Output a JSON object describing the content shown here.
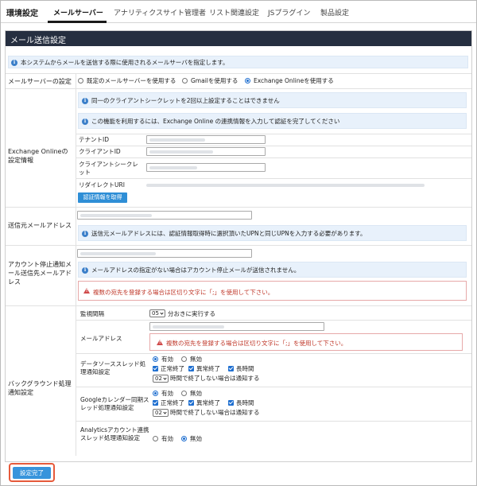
{
  "nav": {
    "title": "環境設定",
    "tabs": [
      "メールサーバー",
      "アナリティクスサイト管理者",
      "リスト関連設定",
      "JSプラグイン",
      "製品設定"
    ]
  },
  "section": {
    "title": "メール送信設定"
  },
  "intro": "本システムからメールを送信する際に使用されるメールサーバを指定します。",
  "mailserver": {
    "label": "メールサーバーの設定",
    "options": [
      "既定のメールサーバーを使用する",
      "Gmailを使用する",
      "Exchange Onlineを使用する"
    ],
    "selected": 2
  },
  "exchange": {
    "label": "Exchange Onlineの設定情報",
    "info1": "同一のクライアントシークレットを2回以上設定することはできません",
    "info2": "この機能を利用するには、Exchange Online の連携情報を入力して認証を完了してください",
    "fields": [
      "テナントID",
      "クライアントID",
      "クライアントシークレット",
      "リダイレクトURI"
    ],
    "auth_button": "認証情報を取得"
  },
  "sender": {
    "label": "送信元メールアドレス",
    "info": "送信元メールアドレスには、認証情報取得時に選択頂いたUPNと同じUPNを入力する必要があります。"
  },
  "stop_notify": {
    "label": "アカウント停止通知メール送信先メールアドレス",
    "info": "メールアドレスの指定がない場合はアカウント停止メールが送信されません。",
    "warn": "複数の宛先を登録する場合は区切り文字に「;」を使用して下さい。"
  },
  "background": {
    "label": "バックグラウンド処理通知設定",
    "interval_label": "監視間隔",
    "interval_value": "05",
    "interval_suffix": "分おきに実行する",
    "email_label": "メールアドレス",
    "email_warn": "複数の宛先を登録する場合は区切り文字に「;」を使用して下さい。",
    "ds_label": "データソーススレッド処理通知設定",
    "ds_radio": [
      "有効",
      "無効"
    ],
    "ds_checks": [
      "正常終了",
      "異常終了",
      "長時間"
    ],
    "ds_hours": "02",
    "ds_hours_suffix": "時間で終了しない場合は通知する",
    "gc_label": "Googleカレンダー同期スレッド処理通知設定",
    "gc_radio": [
      "有効",
      "無効"
    ],
    "gc_checks": [
      "正常終了",
      "異常終了",
      "長時間"
    ],
    "gc_hours": "02",
    "gc_hours_suffix": "時間で終了しない場合は通知する",
    "an_label": "Analyticsアカウント連携スレッド処理通知設定",
    "an_radio": [
      "有効",
      "無効"
    ]
  },
  "submit": "設定完了",
  "colors": {
    "header": "#262f40",
    "accent": "#2e8ed6",
    "warn": "#c0392b",
    "highlight": "#e65a3b"
  }
}
